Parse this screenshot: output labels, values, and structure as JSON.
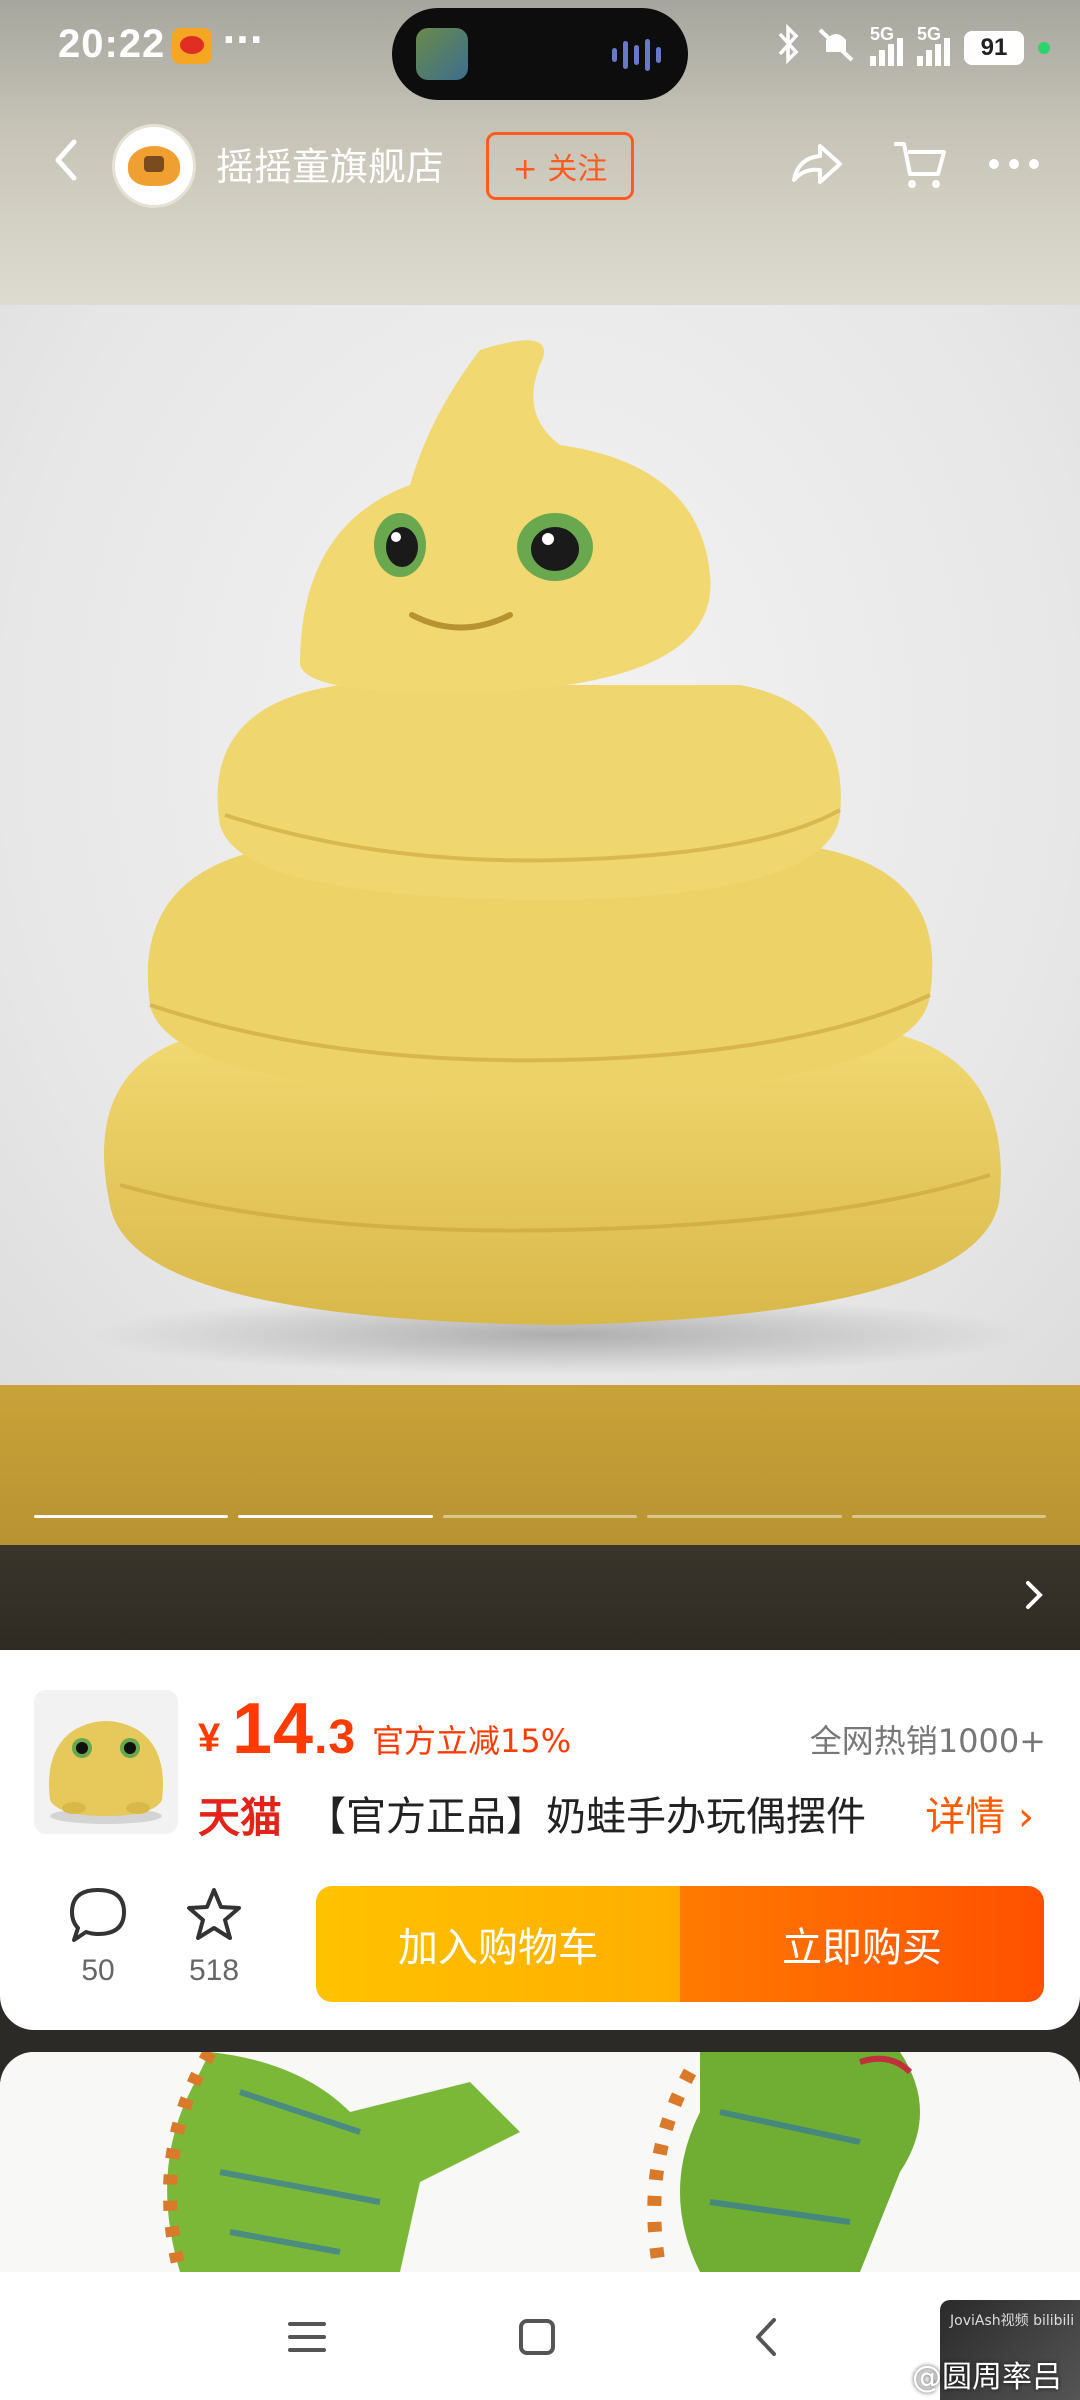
{
  "status_bar": {
    "time": "20:22",
    "more": "···",
    "signal_1": "5G",
    "signal_2": "5G",
    "battery": "91"
  },
  "header": {
    "store_name": "摇摇童旗舰店",
    "follow_label": "+ 关注"
  },
  "gallery": {
    "pages_total": 5,
    "pages_viewed": 2
  },
  "product": {
    "currency": "¥",
    "price_int": "14",
    "price_dec": ".3",
    "discount": "官方立减15%",
    "sales": "全网热销1000+",
    "platform": "天猫",
    "title": "【官方正品】奶蛙手办玩偶摆件",
    "detail_link": "详情 ›"
  },
  "actions": {
    "comments_count": "50",
    "favorites_count": "518",
    "add_to_cart": "加入购物车",
    "buy_now": "立即购买"
  },
  "watermark": {
    "thumb_text": "JoviAsh视频 bilibili",
    "text": "@圆周率吕"
  },
  "colors": {
    "accent": "#ff5a1f",
    "price": "#ff3b00",
    "cart": "#ffb300",
    "buy": "#ff6000"
  }
}
